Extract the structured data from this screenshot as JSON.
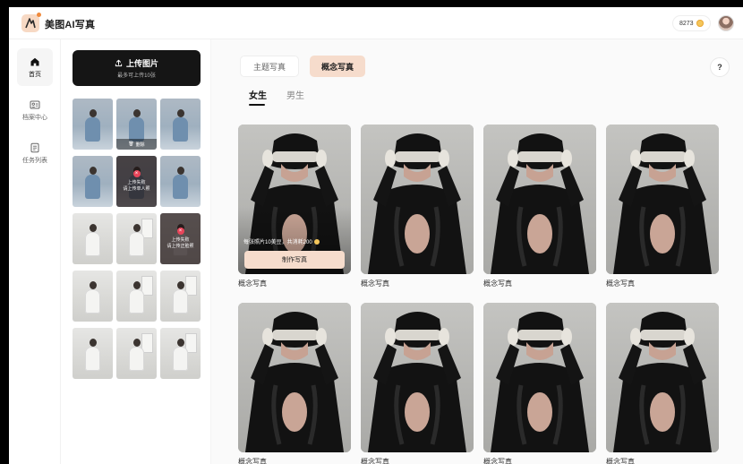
{
  "app": {
    "title": "美图AI写真",
    "coins": "8273"
  },
  "nav": {
    "items": [
      {
        "label": "首页",
        "icon": "home-icon",
        "active": true
      },
      {
        "label": "档案中心",
        "icon": "profile-card-icon",
        "active": false
      },
      {
        "label": "任务列表",
        "icon": "task-list-icon",
        "active": false
      }
    ]
  },
  "upload": {
    "button_label": "上传图片",
    "button_hint": "最多可上传10张",
    "delete_label": "删除",
    "errors": {
      "multi_person": "上传失败\n请上传单人照",
      "front_face": "上传失败\n请上传正脸照"
    }
  },
  "main": {
    "tabs": [
      {
        "label": "主题写真",
        "active": false
      },
      {
        "label": "概念写真",
        "active": true
      }
    ],
    "genders": [
      {
        "label": "女生",
        "active": true
      },
      {
        "label": "男生",
        "active": false
      }
    ],
    "help": "?",
    "promo_text": "每张照片10美豆，共消耗200",
    "make_button": "制作写真",
    "cards": [
      {
        "label": "概念写真"
      },
      {
        "label": "概念写真"
      },
      {
        "label": "概念写真"
      },
      {
        "label": "概念写真"
      },
      {
        "label": "概念写真"
      },
      {
        "label": "概念写真"
      },
      {
        "label": "概念写真"
      },
      {
        "label": "概念写真"
      }
    ]
  },
  "colors": {
    "accent": "#f6dccc",
    "dark_button": "#151515",
    "error": "#e8455a"
  }
}
